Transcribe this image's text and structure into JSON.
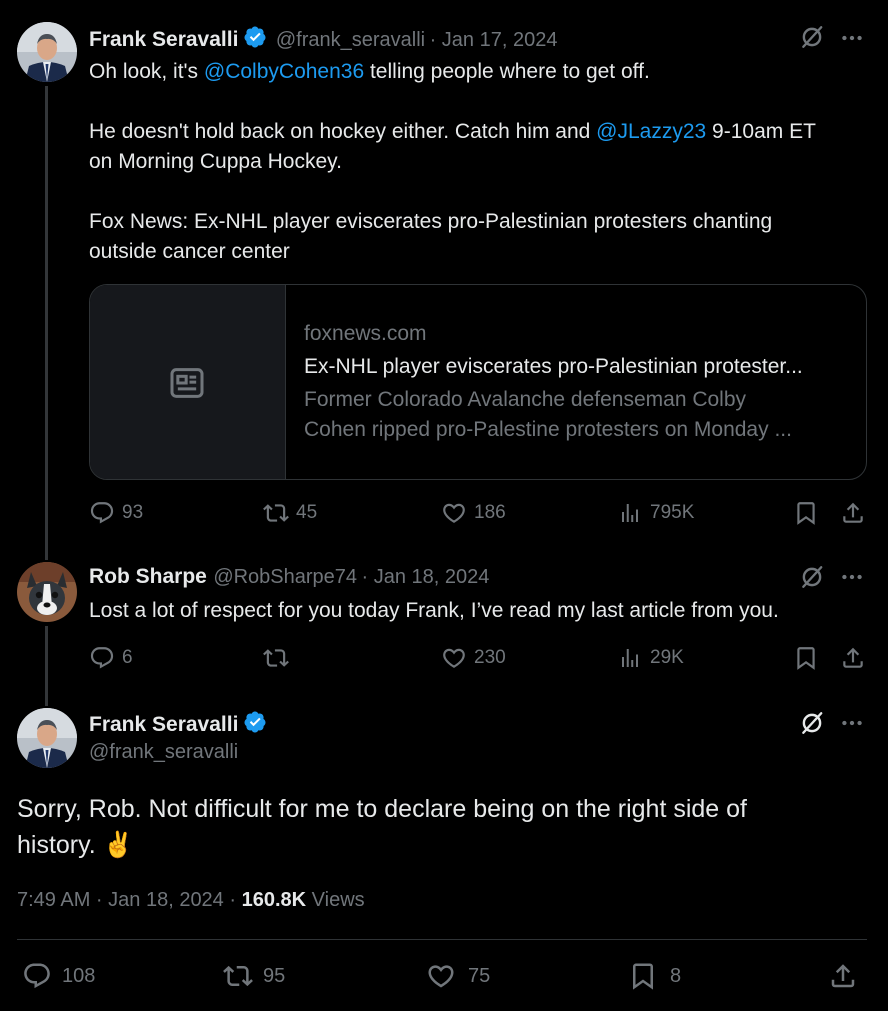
{
  "tweet1": {
    "author": "Frank Seravalli",
    "handle": "@frank_seravalli",
    "date": "· Jan 17, 2024",
    "line1_prefix": "Oh look, it's ",
    "line1_mention": "@ColbyCohen36",
    "line1_suffix": " telling people where to get off.",
    "line2_prefix": "He doesn't hold back on hockey either. Catch him and ",
    "line2_mention": "@JLazzy23",
    "line2_suffix": " 9-10am ET",
    "line3": "on Morning Cuppa Hockey.",
    "line4": "Fox News: Ex-NHL player eviscerates pro-Palestinian protesters chanting",
    "line5": "outside cancer center",
    "card": {
      "domain": "foxnews.com",
      "title": "Ex-NHL player eviscerates pro-Palestinian protester...",
      "desc1": "Former Colorado Avalanche defenseman Colby",
      "desc2": "Cohen ripped pro-Palestine protesters on Monday ..."
    },
    "replies": "93",
    "reposts": "45",
    "likes": "186",
    "views": "795K"
  },
  "tweet2": {
    "author": "Rob Sharpe",
    "handle": "@RobSharpe74",
    "date": "· Jan 18, 2024",
    "text": "Lost a lot of respect for you today Frank, I’ve read my last article from you.",
    "replies": "6",
    "reposts": "",
    "likes": "230",
    "views": "29K"
  },
  "tweet3": {
    "author": "Frank Seravalli",
    "handle": "@frank_seravalli",
    "text_line1": "Sorry, Rob. Not difficult for me to declare being on the right side of",
    "text_line2": "history. ✌️",
    "time": "7:49 AM · Jan 18, 2024 · ",
    "views_count": "160.8K",
    "views_label": " Views",
    "replies": "108",
    "reposts": "95",
    "likes": "75",
    "bookmarks": "8"
  },
  "colors": {
    "accent": "#1d9bf0",
    "muted": "#71767b",
    "text": "#e7e9ea",
    "background": "#000000"
  }
}
